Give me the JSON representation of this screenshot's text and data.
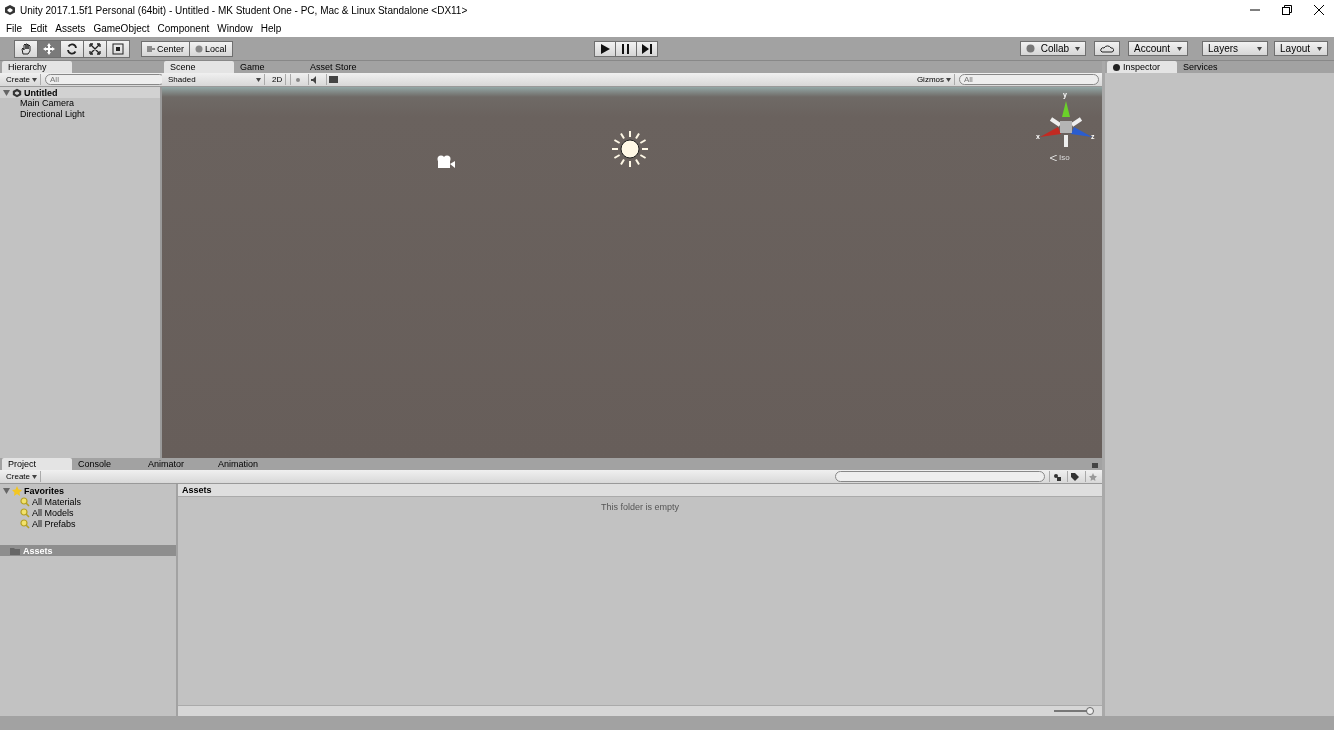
{
  "window": {
    "title": "Unity 2017.1.5f1 Personal (64bit) - Untitled - MK Student One - PC, Mac & Linux Standalone <DX11>"
  },
  "menu": [
    "File",
    "Edit",
    "Assets",
    "GameObject",
    "Component",
    "Window",
    "Help"
  ],
  "toolbar": {
    "tools": [
      {
        "kind": "hand",
        "selected": false
      },
      {
        "kind": "move",
        "selected": true
      },
      {
        "kind": "rotate",
        "selected": false
      },
      {
        "kind": "scale",
        "selected": false
      },
      {
        "kind": "rect",
        "selected": false
      }
    ],
    "pivot": [
      "Center",
      "Local"
    ],
    "right": {
      "collab": "Collab",
      "account": "Account",
      "layers": "Layers",
      "layout": "Layout"
    }
  },
  "hierarchy": {
    "tab": "Hierarchy",
    "create": "Create",
    "search_placeholder": "All",
    "scene": "Untitled",
    "items": [
      "Main Camera",
      "Directional Light"
    ]
  },
  "scene_view": {
    "tabs": [
      {
        "label": "Scene",
        "selected": true
      },
      {
        "label": "Game",
        "selected": false
      },
      {
        "label": "Asset Store",
        "selected": false
      }
    ],
    "shading": "Shaded",
    "mode_2d": "2D",
    "gizmos": "Gizmos",
    "search_placeholder": "All",
    "axes": {
      "y": "y",
      "x": "x",
      "z": "z"
    },
    "projection": "Iso"
  },
  "inspector": {
    "tabs": [
      {
        "label": "Inspector",
        "selected": true
      },
      {
        "label": "Services",
        "selected": false
      }
    ]
  },
  "project": {
    "tabs": [
      {
        "label": "Project",
        "selected": true
      },
      {
        "label": "Console",
        "selected": false
      },
      {
        "label": "Animator",
        "selected": false
      },
      {
        "label": "Animation",
        "selected": false
      }
    ],
    "create": "Create",
    "favorites": "Favorites",
    "favorite_items": [
      "All Materials",
      "All Models",
      "All Prefabs"
    ],
    "folders": [
      {
        "label": "Assets",
        "selected": true
      }
    ],
    "breadcrumb": "Assets",
    "empty_message": "This folder is empty",
    "icon_size": {
      "level": 1
    }
  }
}
